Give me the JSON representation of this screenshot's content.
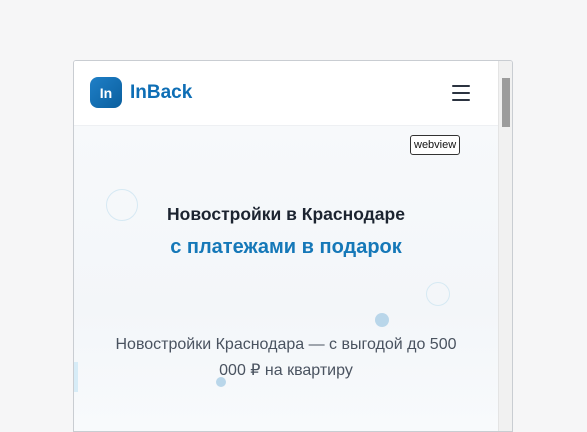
{
  "header": {
    "logo_text": "In",
    "brand_name": "InBack",
    "menu_icon": "hamburger-menu-icon"
  },
  "debug": {
    "webview_label": "webview"
  },
  "hero": {
    "title": "Новостройки в Краснодаре",
    "subtitle": "с платежами в подарок",
    "description": "Новостройки Краснодара — с выгодой до 500 000 ₽ на квартиру"
  },
  "colors": {
    "brand": "#0e6eb5",
    "accent": "#1578b8",
    "text": "#1c2430"
  }
}
